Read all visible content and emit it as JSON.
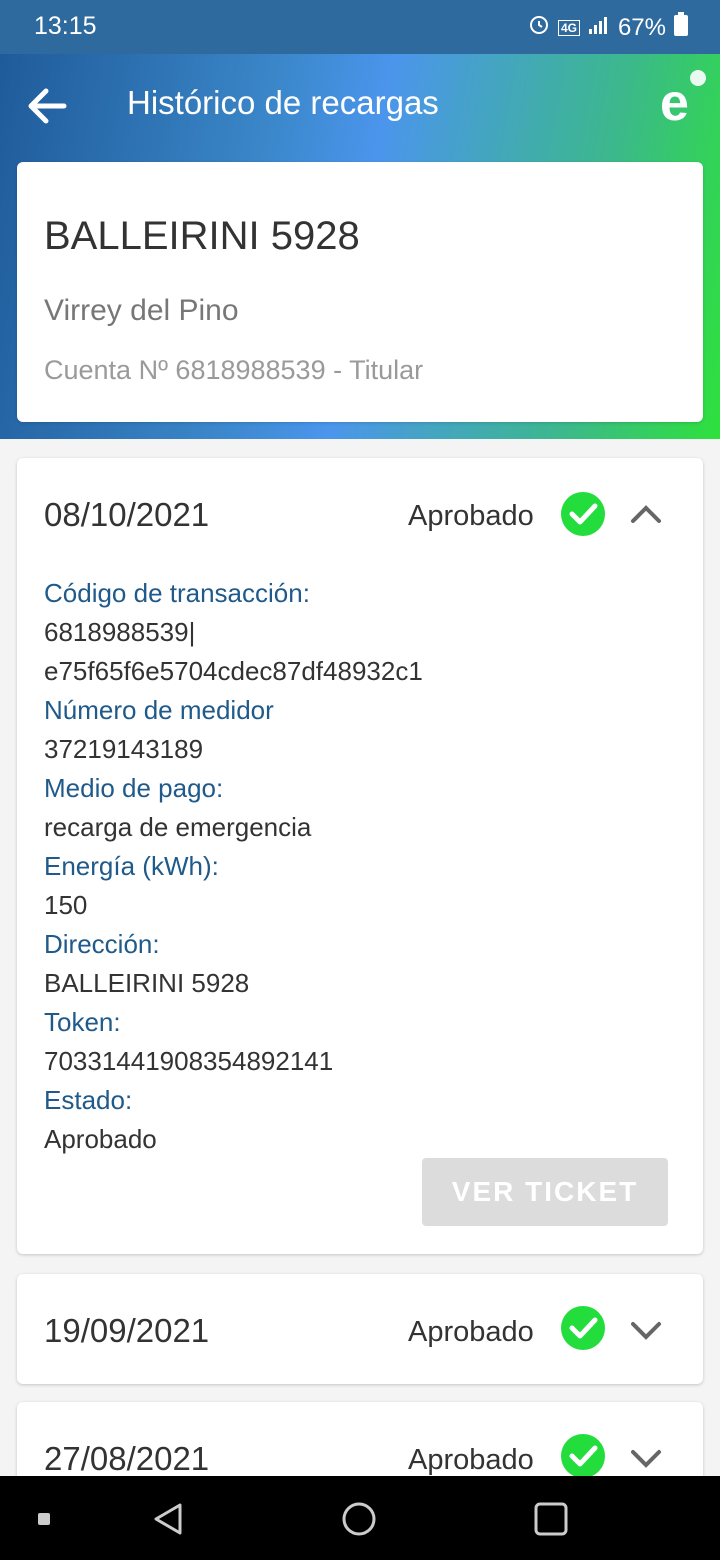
{
  "status_bar": {
    "time": "13:15",
    "battery": "67%",
    "network": "4G"
  },
  "header": {
    "title": "Histórico de recargas",
    "logo_letter": "e"
  },
  "account": {
    "name": "BALLEIRINI 5928",
    "city": "Virrey del Pino",
    "account_line": "Cuenta Nº 6818988539 - Titular"
  },
  "records": [
    {
      "date": "08/10/2021",
      "status": "Aprobado",
      "expanded": true,
      "fields": [
        {
          "label": "Código de transacción:",
          "value": "6818988539|"
        },
        {
          "label": "",
          "value": "e75f65f6e5704cdec87df48932c1"
        },
        {
          "label": "Número de medidor",
          "value": "37219143189"
        },
        {
          "label": "Medio de pago:",
          "value": "recarga de emergencia"
        },
        {
          "label": "Energía (kWh):",
          "value": "150"
        },
        {
          "label": "Dirección:",
          "value": "BALLEIRINI 5928"
        },
        {
          "label": "Token:",
          "value": "70331441908354892141"
        },
        {
          "label": "Estado:",
          "value": "Aprobado"
        }
      ],
      "button_label": "VER TICKET"
    },
    {
      "date": "19/09/2021",
      "status": "Aprobado",
      "expanded": false
    },
    {
      "date": "27/08/2021",
      "status": "Aprobado",
      "expanded": false
    }
  ],
  "colors": {
    "accent_green": "#2ee13c",
    "label_blue": "#1f5a8a",
    "check_green": "#22dd3c"
  }
}
